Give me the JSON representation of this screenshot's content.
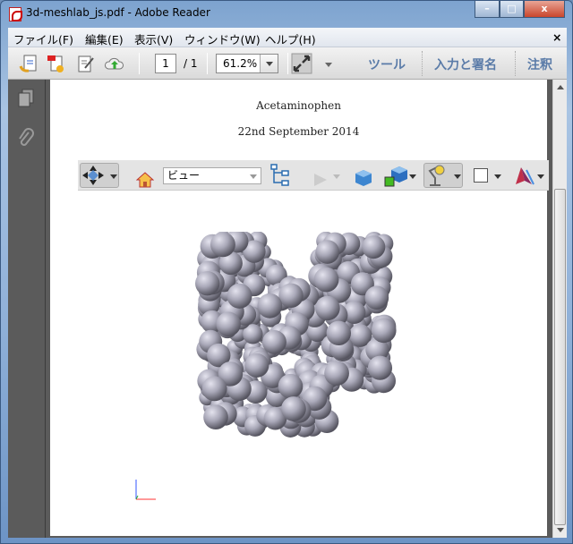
{
  "window": {
    "title": "3d-meshlab_js.pdf - Adobe Reader",
    "controls": {
      "minimize": "–",
      "maximize": "□",
      "close": "x"
    }
  },
  "menu": {
    "items": [
      "ファイル(F)",
      "編集(E)",
      "表示(V)",
      "ウィンドウ(W)",
      "ヘルプ(H)"
    ],
    "close": "×"
  },
  "toolbar": {
    "page_current": "1",
    "page_total": "/ 1",
    "zoom": "61.2%",
    "tools": "ツール",
    "sign": "入力と署名",
    "comment": "注釈"
  },
  "document": {
    "author": "Acetaminophen",
    "date": "22nd September 2014"
  },
  "toolbar3d": {
    "view_select": "ビュー"
  },
  "colors": {
    "accent": "#5a7ba8",
    "sphere": "#a9a8b8"
  }
}
